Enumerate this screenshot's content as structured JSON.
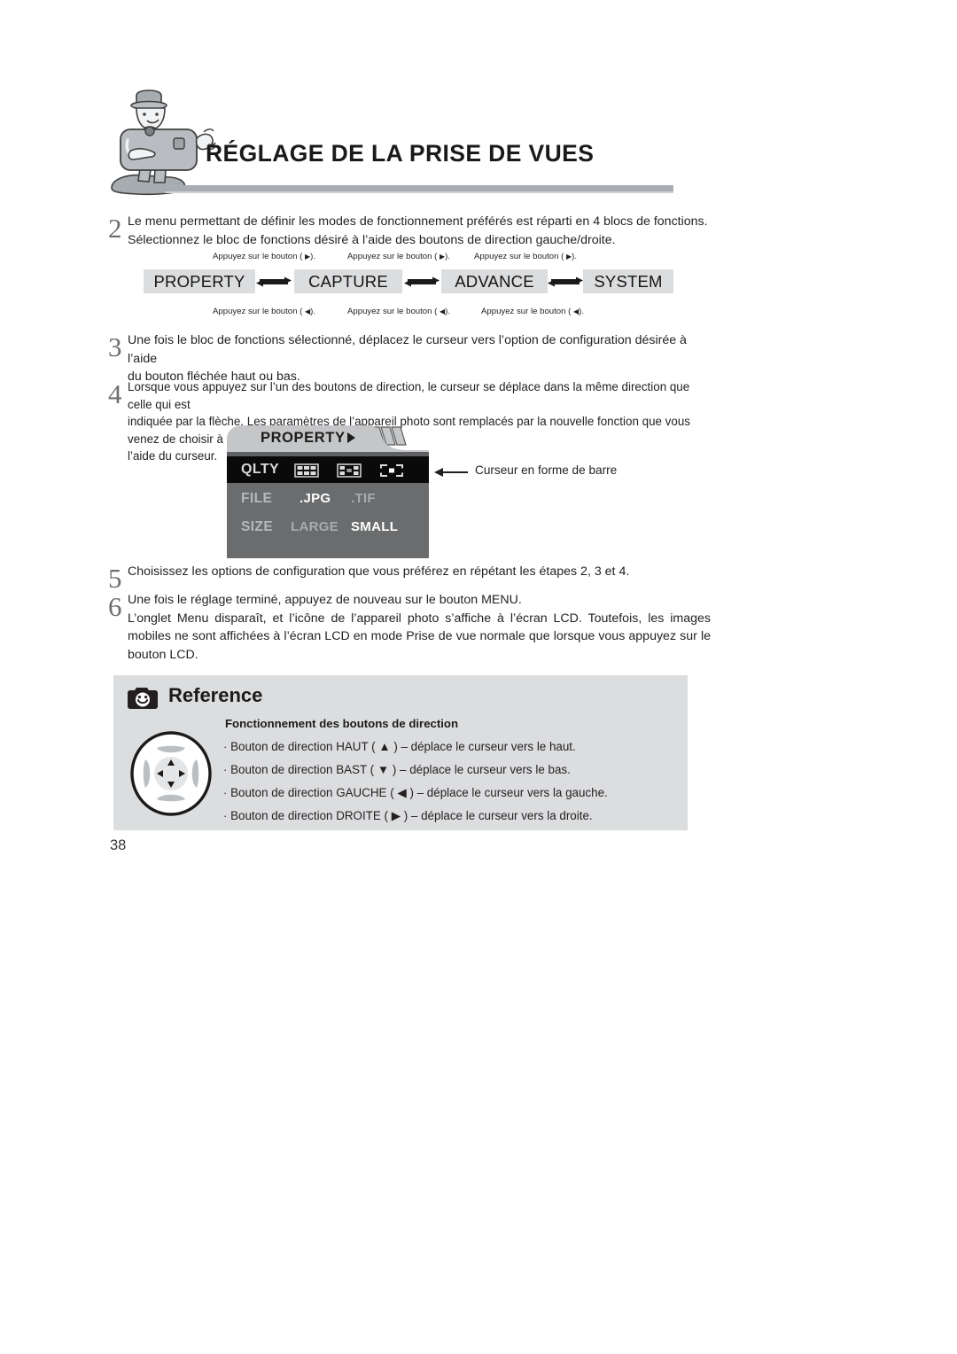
{
  "header": {
    "title": "RÉGLAGE DE LA PRISE DE VUES",
    "mascot_icon": "camera-mascot-icon"
  },
  "steps": [
    {
      "number": "2",
      "lines": [
        "Le menu permettant de définir les modes de fonctionnement préférés est réparti en 4 blocs de fonctions.",
        "Sélectionnez le bloc de fonctions désiré à l’aide des boutons de direction gauche/droite."
      ]
    },
    {
      "number": "3",
      "lines": [
        "Une fois le bloc de fonctions sélectionné, déplacez le curseur vers l’option de configuration désirée à l’aide",
        "du bouton fléchée haut ou bas."
      ]
    },
    {
      "number": "4",
      "lines": [
        "Lorsque vous appuyez sur l’un des boutons de direction, le curseur se déplace dans la même direction que celle qui est",
        "indiquée par la flèche. Les paramètres de l’appareil photo sont remplacés par la nouvelle fonction que vous venez de choisir à",
        "l’aide du curseur."
      ]
    },
    {
      "number": "5",
      "lines": [
        "Choisissez les options de configuration que vous préférez en répétant les étapes 2, 3 et 4."
      ]
    },
    {
      "number": "6",
      "lines": [
        "Une fois le réglage terminé, appuyez de nouveau sur le bouton MENU.",
        "L’onglet Menu disparaît, et l’icône de l’appareil photo s’affiche à l’écran LCD. Toutefois, les images mobiles ne sont affichées à l’écran LCD en mode Prise de vue normale que lorsque vous appuyez sur le bouton LCD."
      ]
    }
  ],
  "tab_flow": {
    "boxes": [
      "PROPERTY",
      "CAPTURE",
      "ADVANCE",
      "SYSTEM"
    ],
    "captions_top": [
      "Appuyez sur le bouton (  ).",
      "Appuyez sur le bouton (  ).",
      "Appuyez sur le bouton (  )."
    ],
    "captions_bottom": [
      "Appuyez sur le bouton (  ).",
      "Appuyez sur le bouton (  ).",
      "Appuyez sur le bouton (  )."
    ],
    "caption_top_glyph": "▶",
    "caption_bottom_glyph": "◀",
    "box_bg": "#dcdddf",
    "arrow_icon": "bidirectional-arrows-icon"
  },
  "lcd": {
    "tab_title": "PROPERTY",
    "tab_arrow_icon": "triangle-right-icon",
    "rows": {
      "qlty": {
        "label": "QLTY",
        "icons": [
          "quality-fine-grid-icon",
          "quality-normal-checker-icon",
          "quality-basic-frame-icon"
        ]
      },
      "file": {
        "label": "FILE",
        "options": [
          {
            "label": ".JPG",
            "selected": true
          },
          {
            "label": ".TIF",
            "selected": false
          }
        ]
      },
      "size": {
        "label": "SIZE",
        "options": [
          {
            "label": "LARGE",
            "selected": false
          },
          {
            "label": "SMALL",
            "selected": true
          }
        ]
      }
    },
    "colors": {
      "highlight_row_bg": "#0a0a0a",
      "panel_bg": "#6a6c6e",
      "tab_bg": "#c4c6c8"
    }
  },
  "callout": {
    "text": "Curseur en forme de barre",
    "arrow_icon": "arrow-left-icon"
  },
  "reference": {
    "title": "Reference",
    "icon": "camera-smiley-icon",
    "subtitle": "Fonctionnement des boutons de direction",
    "pad_icon": "four-way-direction-pad-icon",
    "items": [
      {
        "bullet": "·",
        "text_before": "Bouton de direction HAUT (",
        "glyph": "▲",
        "text_after": ") – déplace le curseur vers le haut."
      },
      {
        "bullet": "·",
        "text_before": "Bouton de direction BAST (",
        "glyph": "▼",
        "text_after": ") – déplace le curseur vers le bas."
      },
      {
        "bullet": "·",
        "text_before": "Bouton de direction GAUCHE (",
        "glyph": "◀",
        "text_after": ") – déplace le curseur vers la gauche."
      },
      {
        "bullet": "·",
        "text_before": "Bouton de direction DROITE (",
        "glyph": "▶",
        "text_after": ") – déplace le curseur vers la droite."
      }
    ],
    "bg": "#dcdddf"
  },
  "page_number": "38"
}
